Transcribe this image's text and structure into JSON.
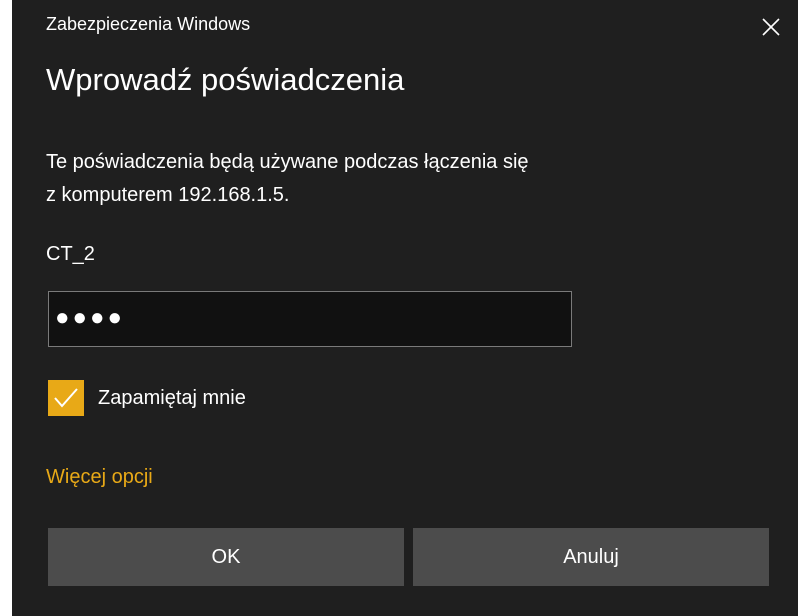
{
  "window": {
    "title": "Zabezpieczenia Windows",
    "close_icon": "close-icon"
  },
  "dialog": {
    "heading": "Wprowadź poświadczenia",
    "description_line1": "Te poświadczenia będą używane podczas łączenia się",
    "description_line2": "z komputerem 192.168.1.5.",
    "username": "CT_2",
    "password_masked": "●●●●",
    "remember_label": "Zapamiętaj mnie",
    "remember_checked": true,
    "more_options_label": "Więcej opcji",
    "ok_label": "OK",
    "cancel_label": "Anuluj"
  },
  "colors": {
    "background": "#1f1f1f",
    "accent": "#e8a917",
    "button": "#4c4c4c",
    "field": "#111111",
    "field_border": "#7a7a7a"
  }
}
